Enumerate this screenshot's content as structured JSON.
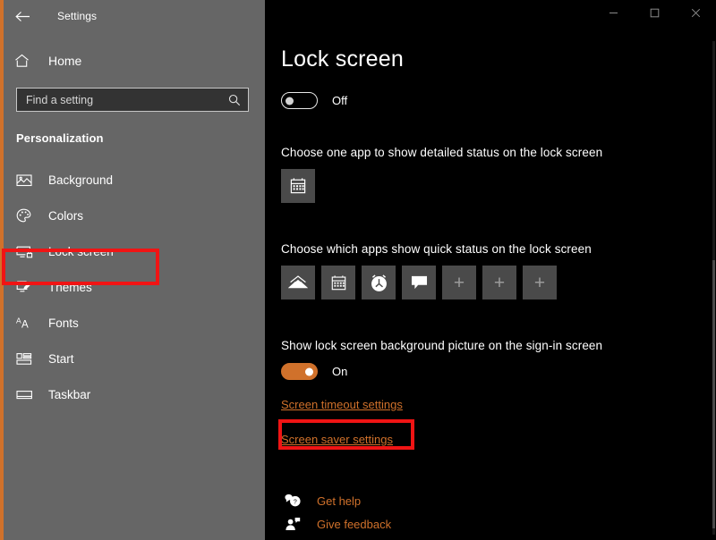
{
  "window": {
    "app_title": "Settings",
    "back_icon": "back-arrow-icon",
    "controls": {
      "minimize": "–",
      "maximize": "▢",
      "close": "✕"
    }
  },
  "sidebar": {
    "home": {
      "label": "Home",
      "icon": "home-icon"
    },
    "search": {
      "placeholder": "Find a setting",
      "icon": "search-icon"
    },
    "section_title": "Personalization",
    "items": [
      {
        "label": "Background",
        "icon": "image-icon",
        "selected": false
      },
      {
        "label": "Colors",
        "icon": "palette-icon",
        "selected": false
      },
      {
        "label": "Lock screen",
        "icon": "lock-screen-icon",
        "selected": true
      },
      {
        "label": "Themes",
        "icon": "theme-brush-icon",
        "selected": false
      },
      {
        "label": "Fonts",
        "icon": "fonts-aa-icon",
        "selected": false
      },
      {
        "label": "Start",
        "icon": "start-tiles-icon",
        "selected": false
      },
      {
        "label": "Taskbar",
        "icon": "taskbar-icon",
        "selected": false
      }
    ]
  },
  "main": {
    "page_title": "Lock screen",
    "top_toggle": {
      "state_label": "Off",
      "on": false
    },
    "detailed_status": {
      "caption": "Choose one app to show detailed status on the lock screen",
      "tiles": [
        {
          "icon": "calendar-icon",
          "type": "app"
        }
      ]
    },
    "quick_status": {
      "caption": "Choose which apps show quick status on the lock screen",
      "tiles": [
        {
          "icon": "mail-icon",
          "type": "app"
        },
        {
          "icon": "calendar-icon",
          "type": "app"
        },
        {
          "icon": "alarm-clock-icon",
          "type": "app"
        },
        {
          "icon": "message-bubble-icon",
          "type": "app"
        },
        {
          "icon": "plus-icon",
          "type": "add",
          "label": "+"
        },
        {
          "icon": "plus-icon",
          "type": "add",
          "label": "+"
        },
        {
          "icon": "plus-icon",
          "type": "add",
          "label": "+"
        }
      ]
    },
    "background_picture": {
      "caption": "Show lock screen background picture on the sign-in screen",
      "toggle": {
        "state_label": "On",
        "on": true
      }
    },
    "links": [
      {
        "label": "Screen timeout settings",
        "highlighted": false
      },
      {
        "label": "Screen saver settings",
        "highlighted": true
      }
    ],
    "help": [
      {
        "label": "Get help",
        "icon": "help-bubble-icon"
      },
      {
        "label": "Give feedback",
        "icon": "feedback-person-icon"
      }
    ]
  },
  "annotations": {
    "color": "#F01414",
    "boxes": [
      {
        "target": "sidebar-item-lock-screen"
      },
      {
        "target": "link-screen-saver-settings"
      }
    ]
  },
  "colors": {
    "accent": "#D0712B",
    "sidebar_bg": "#666666",
    "main_bg": "#000000",
    "tile_bg": "#4a4a4a",
    "annotation_red": "#F01414"
  }
}
